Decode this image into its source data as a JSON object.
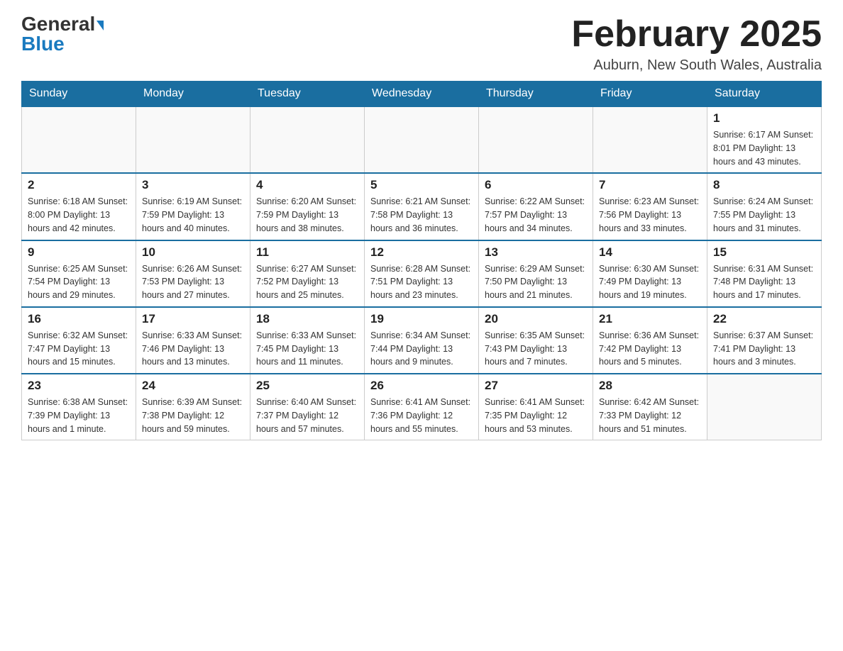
{
  "header": {
    "logo_general": "General",
    "logo_blue": "Blue",
    "title": "February 2025",
    "subtitle": "Auburn, New South Wales, Australia"
  },
  "days_of_week": [
    "Sunday",
    "Monday",
    "Tuesday",
    "Wednesday",
    "Thursday",
    "Friday",
    "Saturday"
  ],
  "weeks": [
    [
      {
        "day": "",
        "info": ""
      },
      {
        "day": "",
        "info": ""
      },
      {
        "day": "",
        "info": ""
      },
      {
        "day": "",
        "info": ""
      },
      {
        "day": "",
        "info": ""
      },
      {
        "day": "",
        "info": ""
      },
      {
        "day": "1",
        "info": "Sunrise: 6:17 AM\nSunset: 8:01 PM\nDaylight: 13 hours and 43 minutes."
      }
    ],
    [
      {
        "day": "2",
        "info": "Sunrise: 6:18 AM\nSunset: 8:00 PM\nDaylight: 13 hours and 42 minutes."
      },
      {
        "day": "3",
        "info": "Sunrise: 6:19 AM\nSunset: 7:59 PM\nDaylight: 13 hours and 40 minutes."
      },
      {
        "day": "4",
        "info": "Sunrise: 6:20 AM\nSunset: 7:59 PM\nDaylight: 13 hours and 38 minutes."
      },
      {
        "day": "5",
        "info": "Sunrise: 6:21 AM\nSunset: 7:58 PM\nDaylight: 13 hours and 36 minutes."
      },
      {
        "day": "6",
        "info": "Sunrise: 6:22 AM\nSunset: 7:57 PM\nDaylight: 13 hours and 34 minutes."
      },
      {
        "day": "7",
        "info": "Sunrise: 6:23 AM\nSunset: 7:56 PM\nDaylight: 13 hours and 33 minutes."
      },
      {
        "day": "8",
        "info": "Sunrise: 6:24 AM\nSunset: 7:55 PM\nDaylight: 13 hours and 31 minutes."
      }
    ],
    [
      {
        "day": "9",
        "info": "Sunrise: 6:25 AM\nSunset: 7:54 PM\nDaylight: 13 hours and 29 minutes."
      },
      {
        "day": "10",
        "info": "Sunrise: 6:26 AM\nSunset: 7:53 PM\nDaylight: 13 hours and 27 minutes."
      },
      {
        "day": "11",
        "info": "Sunrise: 6:27 AM\nSunset: 7:52 PM\nDaylight: 13 hours and 25 minutes."
      },
      {
        "day": "12",
        "info": "Sunrise: 6:28 AM\nSunset: 7:51 PM\nDaylight: 13 hours and 23 minutes."
      },
      {
        "day": "13",
        "info": "Sunrise: 6:29 AM\nSunset: 7:50 PM\nDaylight: 13 hours and 21 minutes."
      },
      {
        "day": "14",
        "info": "Sunrise: 6:30 AM\nSunset: 7:49 PM\nDaylight: 13 hours and 19 minutes."
      },
      {
        "day": "15",
        "info": "Sunrise: 6:31 AM\nSunset: 7:48 PM\nDaylight: 13 hours and 17 minutes."
      }
    ],
    [
      {
        "day": "16",
        "info": "Sunrise: 6:32 AM\nSunset: 7:47 PM\nDaylight: 13 hours and 15 minutes."
      },
      {
        "day": "17",
        "info": "Sunrise: 6:33 AM\nSunset: 7:46 PM\nDaylight: 13 hours and 13 minutes."
      },
      {
        "day": "18",
        "info": "Sunrise: 6:33 AM\nSunset: 7:45 PM\nDaylight: 13 hours and 11 minutes."
      },
      {
        "day": "19",
        "info": "Sunrise: 6:34 AM\nSunset: 7:44 PM\nDaylight: 13 hours and 9 minutes."
      },
      {
        "day": "20",
        "info": "Sunrise: 6:35 AM\nSunset: 7:43 PM\nDaylight: 13 hours and 7 minutes."
      },
      {
        "day": "21",
        "info": "Sunrise: 6:36 AM\nSunset: 7:42 PM\nDaylight: 13 hours and 5 minutes."
      },
      {
        "day": "22",
        "info": "Sunrise: 6:37 AM\nSunset: 7:41 PM\nDaylight: 13 hours and 3 minutes."
      }
    ],
    [
      {
        "day": "23",
        "info": "Sunrise: 6:38 AM\nSunset: 7:39 PM\nDaylight: 13 hours and 1 minute."
      },
      {
        "day": "24",
        "info": "Sunrise: 6:39 AM\nSunset: 7:38 PM\nDaylight: 12 hours and 59 minutes."
      },
      {
        "day": "25",
        "info": "Sunrise: 6:40 AM\nSunset: 7:37 PM\nDaylight: 12 hours and 57 minutes."
      },
      {
        "day": "26",
        "info": "Sunrise: 6:41 AM\nSunset: 7:36 PM\nDaylight: 12 hours and 55 minutes."
      },
      {
        "day": "27",
        "info": "Sunrise: 6:41 AM\nSunset: 7:35 PM\nDaylight: 12 hours and 53 minutes."
      },
      {
        "day": "28",
        "info": "Sunrise: 6:42 AM\nSunset: 7:33 PM\nDaylight: 12 hours and 51 minutes."
      },
      {
        "day": "",
        "info": ""
      }
    ]
  ]
}
